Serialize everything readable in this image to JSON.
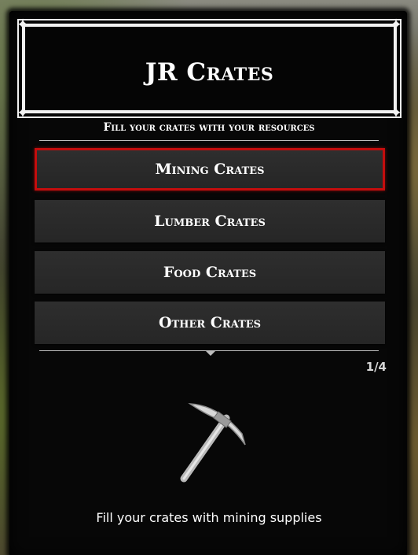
{
  "header": {
    "title": "JR Crates"
  },
  "subtitle": "Fill your crates with your resources",
  "menu": {
    "items": [
      {
        "label": "Mining Crates",
        "selected": true
      },
      {
        "label": "Lumber Crates",
        "selected": false
      },
      {
        "label": "Food Crates",
        "selected": false
      },
      {
        "label": "Other Crates",
        "selected": false
      }
    ]
  },
  "pagination": {
    "text": "1/4"
  },
  "preview": {
    "icon": "pickaxe-icon",
    "description": "Fill your crates with mining supplies"
  },
  "colors": {
    "selection_border": "#c40d0d",
    "panel_background": "#070707",
    "item_background": "#2a2a2a",
    "text": "#ffffff"
  }
}
